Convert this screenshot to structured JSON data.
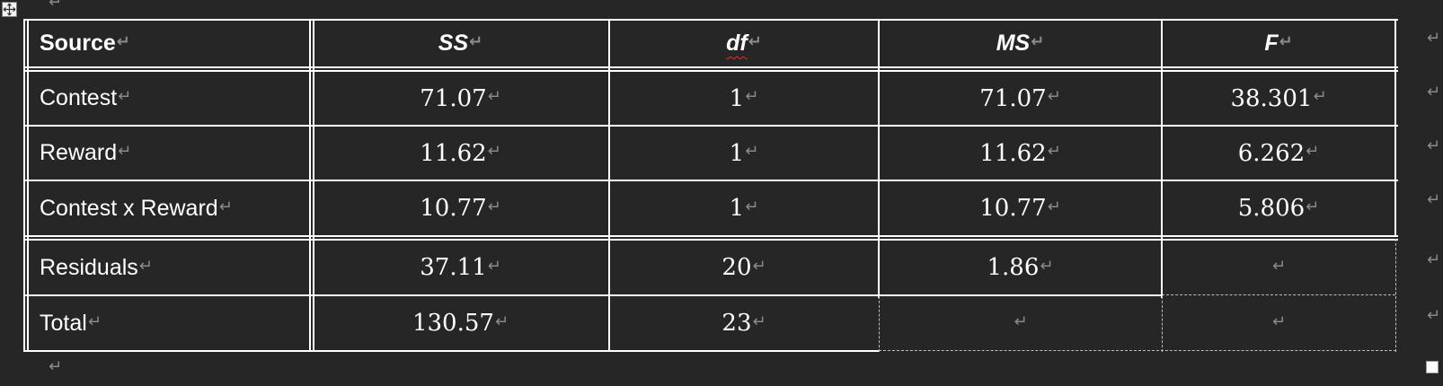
{
  "paragraph_mark": "↵",
  "table": {
    "headers": [
      "Source",
      "SS",
      "df",
      "MS",
      "F"
    ],
    "rows": [
      {
        "source": "Contest",
        "ss": "71.07",
        "df": "1",
        "ms": "71.07",
        "f": "38.301"
      },
      {
        "source": "Reward",
        "ss": "11.62",
        "df": "1",
        "ms": "11.62",
        "f": "6.262"
      },
      {
        "source": "Contest x Reward",
        "ss": "10.77",
        "df": "1",
        "ms": "10.77",
        "f": "5.806"
      },
      {
        "source": "Residuals",
        "ss": "37.11",
        "df": "20",
        "ms": "1.86",
        "f": ""
      },
      {
        "source": "Total",
        "ss": "130.57",
        "df": "23",
        "ms": "",
        "f": ""
      }
    ]
  },
  "colors": {
    "background": "#262626",
    "text": "#ffffff",
    "border": "#ffffff",
    "formatting_mark": "#8a8a8a",
    "spellcheck": "#e03030"
  },
  "icons": {
    "table_move_handle": "four-way-arrow-icon",
    "table_resize_handle": "resize-square-icon"
  }
}
